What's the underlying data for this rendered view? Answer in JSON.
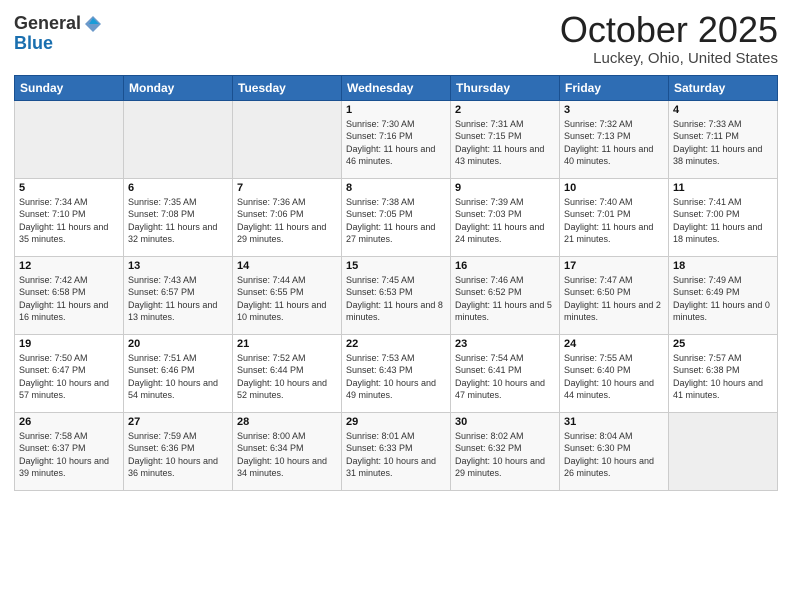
{
  "logo": {
    "general": "General",
    "blue": "Blue"
  },
  "title": "October 2025",
  "location": "Luckey, Ohio, United States",
  "days_of_week": [
    "Sunday",
    "Monday",
    "Tuesday",
    "Wednesday",
    "Thursday",
    "Friday",
    "Saturday"
  ],
  "weeks": [
    [
      {
        "day": "",
        "empty": true
      },
      {
        "day": "",
        "empty": true
      },
      {
        "day": "",
        "empty": true
      },
      {
        "day": "1",
        "sunrise": "7:30 AM",
        "sunset": "7:16 PM",
        "daylight": "11 hours and 46 minutes."
      },
      {
        "day": "2",
        "sunrise": "7:31 AM",
        "sunset": "7:15 PM",
        "daylight": "11 hours and 43 minutes."
      },
      {
        "day": "3",
        "sunrise": "7:32 AM",
        "sunset": "7:13 PM",
        "daylight": "11 hours and 40 minutes."
      },
      {
        "day": "4",
        "sunrise": "7:33 AM",
        "sunset": "7:11 PM",
        "daylight": "11 hours and 38 minutes."
      }
    ],
    [
      {
        "day": "5",
        "sunrise": "7:34 AM",
        "sunset": "7:10 PM",
        "daylight": "11 hours and 35 minutes."
      },
      {
        "day": "6",
        "sunrise": "7:35 AM",
        "sunset": "7:08 PM",
        "daylight": "11 hours and 32 minutes."
      },
      {
        "day": "7",
        "sunrise": "7:36 AM",
        "sunset": "7:06 PM",
        "daylight": "11 hours and 29 minutes."
      },
      {
        "day": "8",
        "sunrise": "7:38 AM",
        "sunset": "7:05 PM",
        "daylight": "11 hours and 27 minutes."
      },
      {
        "day": "9",
        "sunrise": "7:39 AM",
        "sunset": "7:03 PM",
        "daylight": "11 hours and 24 minutes."
      },
      {
        "day": "10",
        "sunrise": "7:40 AM",
        "sunset": "7:01 PM",
        "daylight": "11 hours and 21 minutes."
      },
      {
        "day": "11",
        "sunrise": "7:41 AM",
        "sunset": "7:00 PM",
        "daylight": "11 hours and 18 minutes."
      }
    ],
    [
      {
        "day": "12",
        "sunrise": "7:42 AM",
        "sunset": "6:58 PM",
        "daylight": "11 hours and 16 minutes."
      },
      {
        "day": "13",
        "sunrise": "7:43 AM",
        "sunset": "6:57 PM",
        "daylight": "11 hours and 13 minutes."
      },
      {
        "day": "14",
        "sunrise": "7:44 AM",
        "sunset": "6:55 PM",
        "daylight": "11 hours and 10 minutes."
      },
      {
        "day": "15",
        "sunrise": "7:45 AM",
        "sunset": "6:53 PM",
        "daylight": "11 hours and 8 minutes."
      },
      {
        "day": "16",
        "sunrise": "7:46 AM",
        "sunset": "6:52 PM",
        "daylight": "11 hours and 5 minutes."
      },
      {
        "day": "17",
        "sunrise": "7:47 AM",
        "sunset": "6:50 PM",
        "daylight": "11 hours and 2 minutes."
      },
      {
        "day": "18",
        "sunrise": "7:49 AM",
        "sunset": "6:49 PM",
        "daylight": "11 hours and 0 minutes."
      }
    ],
    [
      {
        "day": "19",
        "sunrise": "7:50 AM",
        "sunset": "6:47 PM",
        "daylight": "10 hours and 57 minutes."
      },
      {
        "day": "20",
        "sunrise": "7:51 AM",
        "sunset": "6:46 PM",
        "daylight": "10 hours and 54 minutes."
      },
      {
        "day": "21",
        "sunrise": "7:52 AM",
        "sunset": "6:44 PM",
        "daylight": "10 hours and 52 minutes."
      },
      {
        "day": "22",
        "sunrise": "7:53 AM",
        "sunset": "6:43 PM",
        "daylight": "10 hours and 49 minutes."
      },
      {
        "day": "23",
        "sunrise": "7:54 AM",
        "sunset": "6:41 PM",
        "daylight": "10 hours and 47 minutes."
      },
      {
        "day": "24",
        "sunrise": "7:55 AM",
        "sunset": "6:40 PM",
        "daylight": "10 hours and 44 minutes."
      },
      {
        "day": "25",
        "sunrise": "7:57 AM",
        "sunset": "6:38 PM",
        "daylight": "10 hours and 41 minutes."
      }
    ],
    [
      {
        "day": "26",
        "sunrise": "7:58 AM",
        "sunset": "6:37 PM",
        "daylight": "10 hours and 39 minutes."
      },
      {
        "day": "27",
        "sunrise": "7:59 AM",
        "sunset": "6:36 PM",
        "daylight": "10 hours and 36 minutes."
      },
      {
        "day": "28",
        "sunrise": "8:00 AM",
        "sunset": "6:34 PM",
        "daylight": "10 hours and 34 minutes."
      },
      {
        "day": "29",
        "sunrise": "8:01 AM",
        "sunset": "6:33 PM",
        "daylight": "10 hours and 31 minutes."
      },
      {
        "day": "30",
        "sunrise": "8:02 AM",
        "sunset": "6:32 PM",
        "daylight": "10 hours and 29 minutes."
      },
      {
        "day": "31",
        "sunrise": "8:04 AM",
        "sunset": "6:30 PM",
        "daylight": "10 hours and 26 minutes."
      },
      {
        "day": "",
        "empty": true
      }
    ]
  ]
}
